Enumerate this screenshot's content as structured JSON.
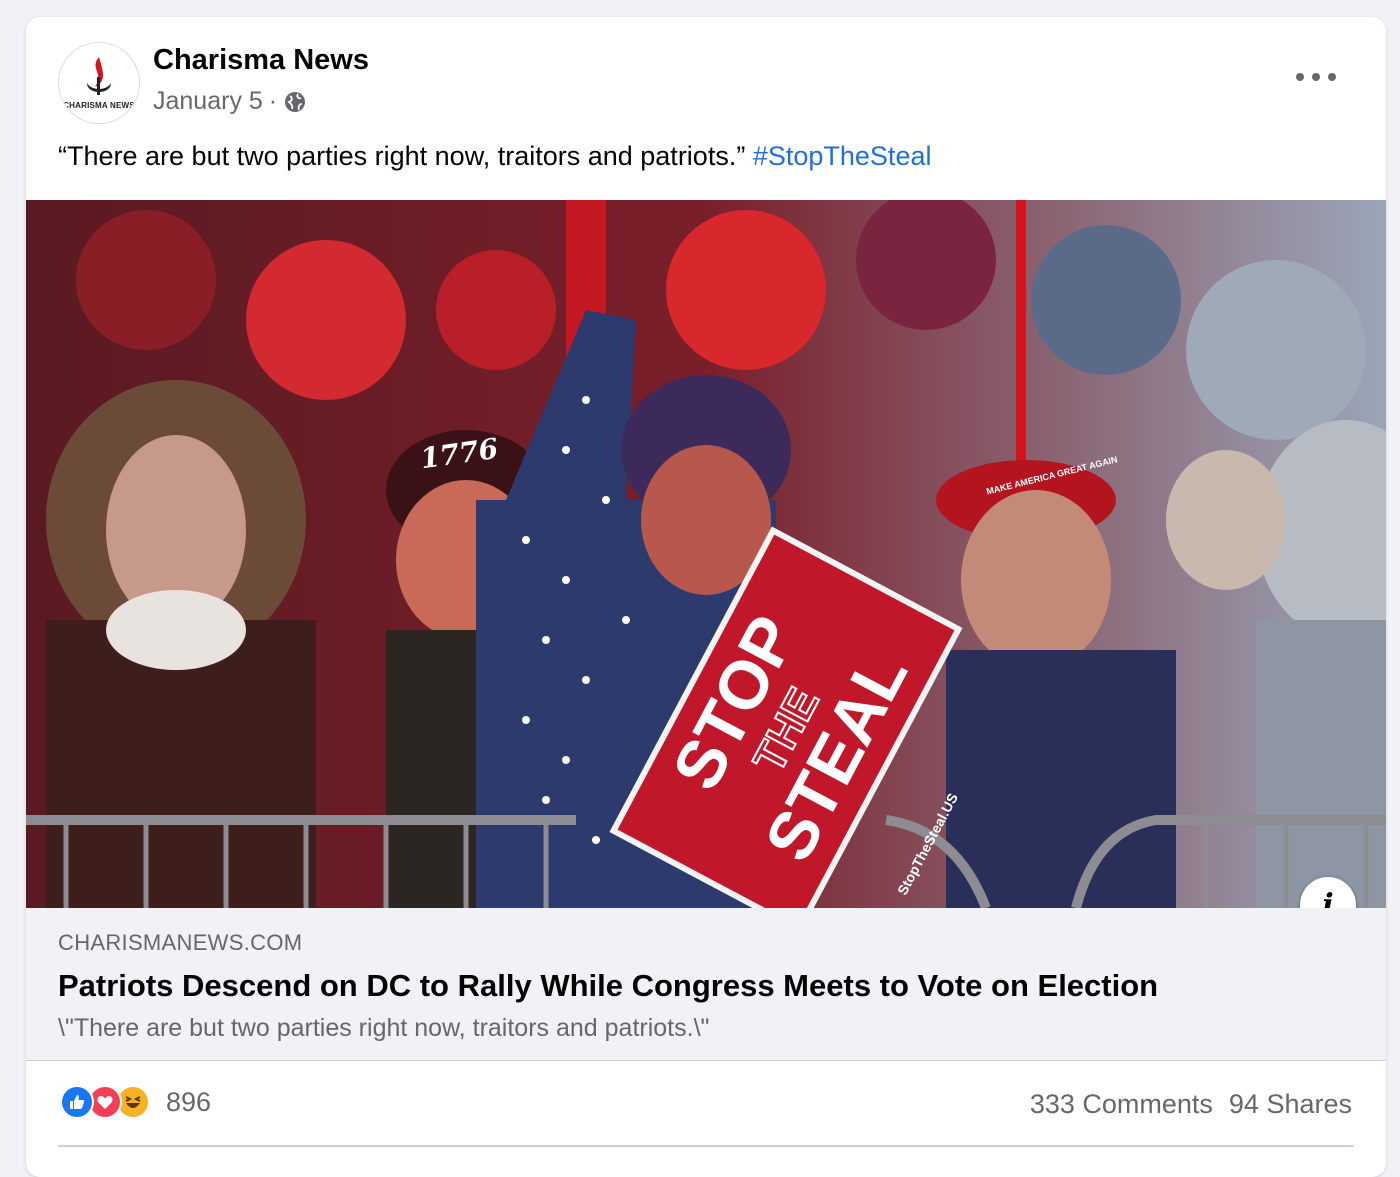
{
  "post": {
    "page_name": "Charisma News",
    "date": "January 5",
    "separator": "·",
    "privacy_icon": "globe-icon",
    "avatar_logo_text": "CHARISMA NEWS",
    "text": "“There are but two parties right now, traitors and patriots.”",
    "hashtag": "#StopTheSteal"
  },
  "photo": {
    "sign_line1": "STOP",
    "sign_line2": "THE",
    "sign_line3": "STEAL",
    "sign_url": "StopTheSteal.US",
    "cap_text": "1776",
    "maga_text": "MAKE AMERICA GREAT AGAIN"
  },
  "link_preview": {
    "domain": "CHARISMANEWS.COM",
    "title": "Patriots Descend on DC to Rally While Congress Meets to Vote on Election",
    "description": "\\\"There are but two parties right now, traitors and patriots.\\\""
  },
  "engagement": {
    "reaction_icons": [
      "like-icon",
      "love-icon",
      "haha-icon"
    ],
    "reaction_count": "896",
    "comments": "333 Comments",
    "shares": "94 Shares"
  },
  "colors": {
    "link_blue": "#216fdb",
    "secondary_text": "#65676b",
    "like_blue": "#1877f2",
    "love_red": "#f33e58",
    "haha_yellow": "#f7b125",
    "sign_red": "#c0182a"
  }
}
